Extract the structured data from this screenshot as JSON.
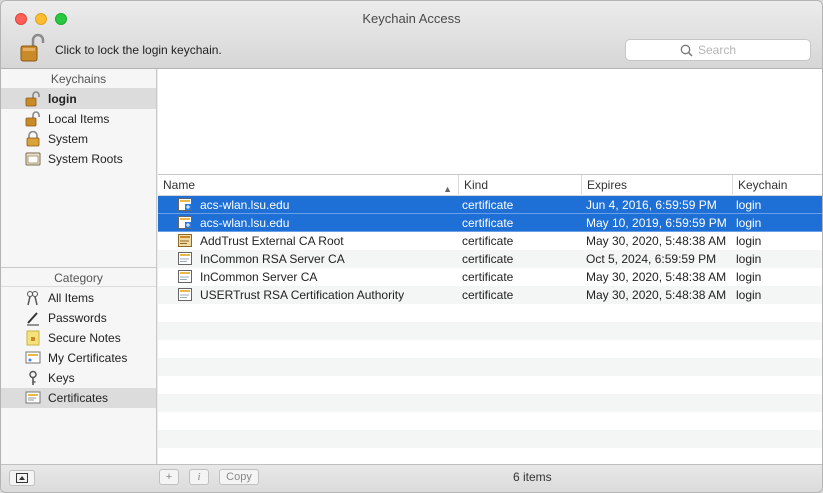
{
  "window": {
    "title": "Keychain Access"
  },
  "toolbar": {
    "lock_label": "Click to lock the login keychain."
  },
  "search": {
    "placeholder": "Search"
  },
  "sidebar": {
    "keychains_header": "Keychains",
    "keychains": [
      {
        "label": "login",
        "icon": "unlocked-padlock-icon",
        "selected": true
      },
      {
        "label": "Local Items",
        "icon": "unlocked-padlock-icon"
      },
      {
        "label": "System",
        "icon": "locked-padlock-icon"
      },
      {
        "label": "System Roots",
        "icon": "cabinet-icon"
      }
    ],
    "category_header": "Category",
    "categories": [
      {
        "label": "All Items",
        "icon": "all-items-icon"
      },
      {
        "label": "Passwords",
        "icon": "password-pen-icon"
      },
      {
        "label": "Secure Notes",
        "icon": "secure-note-icon"
      },
      {
        "label": "My Certificates",
        "icon": "my-certificate-icon"
      },
      {
        "label": "Keys",
        "icon": "key-icon"
      },
      {
        "label": "Certificates",
        "icon": "certificate-icon",
        "selected": true
      }
    ]
  },
  "table": {
    "columns": [
      "Name",
      "Kind",
      "Expires",
      "Keychain"
    ],
    "rows": [
      {
        "name": "acs-wlan.lsu.edu",
        "kind": "certificate",
        "expires": "Jun 4, 2016, 6:59:59 PM",
        "keychain": "login",
        "selected": true,
        "icon": "cert-plus-icon"
      },
      {
        "name": "acs-wlan.lsu.edu",
        "kind": "certificate",
        "expires": "May 10, 2019, 6:59:59 PM",
        "keychain": "login",
        "selected": true,
        "icon": "cert-plus-icon"
      },
      {
        "name": "AddTrust External CA Root",
        "kind": "certificate",
        "expires": "May 30, 2020, 5:48:38 AM",
        "keychain": "login",
        "icon": "root-cert-icon"
      },
      {
        "name": "InCommon RSA Server CA",
        "kind": "certificate",
        "expires": "Oct 5, 2024, 6:59:59 PM",
        "keychain": "login",
        "icon": "cert-icon"
      },
      {
        "name": "InCommon Server CA",
        "kind": "certificate",
        "expires": "May 30, 2020, 5:48:38 AM",
        "keychain": "login",
        "icon": "cert-icon"
      },
      {
        "name": "USERTrust RSA Certification Authority",
        "kind": "certificate",
        "expires": "May 30, 2020, 5:48:38 AM",
        "keychain": "login",
        "icon": "cert-icon"
      }
    ]
  },
  "bottombar": {
    "copy_label": "Copy",
    "status": "6 items"
  },
  "colors": {
    "selection": "#1e6fd6",
    "sidebar_selection": "#dcdcdc"
  }
}
